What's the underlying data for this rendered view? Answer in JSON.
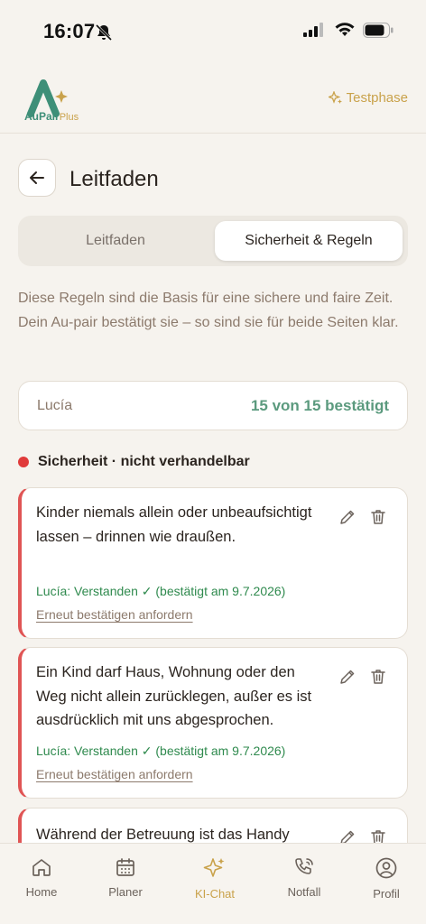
{
  "status_bar": {
    "time": "16:07"
  },
  "header": {
    "logo_text": "AuPair",
    "logo_plus": "Plus",
    "trial_label": "Testphase"
  },
  "page": {
    "title": "Leitfaden"
  },
  "segmented": {
    "tab1": "Leitfaden",
    "tab2": "Sicherheit & Regeln",
    "active": "tab2"
  },
  "intro": "Diese Regeln sind die Basis für eine sichere und faire Zeit. Dein Au-pair bestätigt sie – so sind sie für beide Seiten klar.",
  "summary": {
    "name": "Lucía",
    "status": "15 von 15 bestätigt"
  },
  "section": {
    "title": "Sicherheit · nicht verhandelbar",
    "color": "#e03a3a"
  },
  "rules": [
    {
      "text": "Kinder niemals allein oder unbeaufsichtigt lassen – drinnen wie draußen.",
      "confirm": "Lucía: Verstanden ✓ (bestätigt am 9.7.2026)",
      "link": "Erneut bestätigen anfordern"
    },
    {
      "text": "Ein Kind darf Haus, Wohnung oder den Weg nicht allein zurücklegen, außer es ist ausdrücklich mit uns abgesprochen.",
      "confirm": "Lucía: Verstanden ✓ (bestätigt am 9.7.2026)",
      "link": "Erneut bestätigen anfordern"
    },
    {
      "text": "Während der Betreuung ist das Handy"
    }
  ],
  "tabbar": {
    "home": "Home",
    "planer": "Planer",
    "chat": "KI-Chat",
    "notfall": "Notfall",
    "profil": "Profil",
    "active": "chat"
  },
  "colors": {
    "accent": "#c9a24b",
    "brand": "#3e8f78",
    "confirm": "#2f8a4e",
    "rule_border": "#e05555"
  }
}
